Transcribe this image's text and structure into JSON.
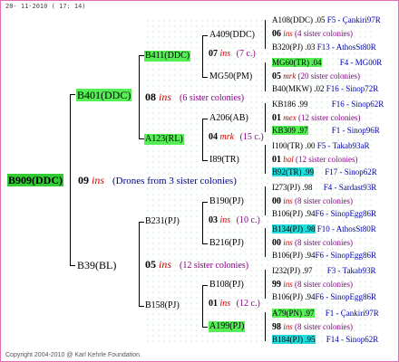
{
  "header": {
    "date": "20- 11-2010 ( 17: 14)"
  },
  "footer": {
    "copyright": "Copyright 2004-2010 @ Karl Kehrle Foundation."
  },
  "root": {
    "id": "B909(DDC)",
    "year": "09",
    "suffix": "ins",
    "note": "(Drones from 3 sister colonies)"
  },
  "gen1": [
    {
      "id": "B401(DDC)",
      "year": "08",
      "suffix": "ins",
      "note": "(6 sister colonies)"
    },
    {
      "id": "B39(BL)",
      "year": "05",
      "suffix": "ins",
      "note": "(12 sister colonies)"
    }
  ],
  "gen2": [
    {
      "id": "B411(DDC)",
      "year": "07",
      "suffix": "ins",
      "note": "(7 c.)"
    },
    {
      "id": "A123(RL)",
      "year": "04",
      "suffix": "mrk",
      "note": "(15 c.)"
    },
    {
      "id": "B231(PJ)",
      "year": "03",
      "suffix": "ins",
      "note": "(10 c.)"
    },
    {
      "id": "B158(PJ)",
      "year": "01",
      "suffix": "ins",
      "note": "(12 c.)"
    }
  ],
  "gen3": [
    "A409(DDC)",
    "MG50(PM)",
    "A206(AB)",
    "I89(TR)",
    "B190(PJ)",
    "B216(PJ)",
    "B108(PJ)",
    "A199(PJ)"
  ],
  "gen4": [
    {
      "top": "A108(DDC) .05",
      "top_r": "F5 - Çankiri97R",
      "year": "06",
      "suffix": "ins",
      "note": "(4 sister colonies)",
      "bot": "B320(PJ) .03",
      "bot_r": "F13 - AthosSt80R"
    },
    {
      "top": "MG60(TR) .04",
      "top_r": "F4 - MG00R",
      "year": "05",
      "suffix": "mrk",
      "note": "(20 sister colonies)",
      "bot": "B40(MKW) .02",
      "bot_r": "F16 - Sinop72R"
    },
    {
      "top": "KB186 .99",
      "top_r": "F16 - Sinop62R",
      "year": "01",
      "suffix": "mex",
      "note": "(12 sister colonies)",
      "bot": "KB309 .97",
      "bot_r": "F1 - Sinop96R"
    },
    {
      "top": "I100(TR) .00",
      "top_r": "F5 - Takab93aR",
      "year": "01",
      "suffix": "bal",
      "note": "(12 sister colonies)",
      "bot": "B92(TR) .99",
      "bot_r": "F17 - Sinop62R"
    },
    {
      "top": "I273(PJ) .98",
      "top_r": "F4 - Sardast93R",
      "year": "00",
      "suffix": "ins",
      "note": "(8 sister colonies)",
      "bot": "B106(PJ) .94",
      "bot_r": "F6 - SinopEgg86R"
    },
    {
      "top": "B134(PJ) .98",
      "top_r": "F10 - AthosSt80R",
      "year": "00",
      "suffix": "ins",
      "note": "(8 sister colonies)",
      "bot": "B106(PJ) .94",
      "bot_r": "F6 - SinopEgg86R"
    },
    {
      "top": "I232(PJ) .97",
      "top_r": "F3 - Takab93R",
      "year": "99",
      "suffix": "ins",
      "note": "(8 sister colonies)",
      "bot": "B106(PJ) .94",
      "bot_r": "F6 - SinopEgg86R"
    },
    {
      "top": "A79(PN) .97",
      "top_r": "F1 - Çankiri97R",
      "year": "98",
      "suffix": "ins",
      "note": "(8 sister colonies)",
      "bot": "B184(PJ) .95",
      "bot_r": "F14 - Sinop62R"
    }
  ]
}
